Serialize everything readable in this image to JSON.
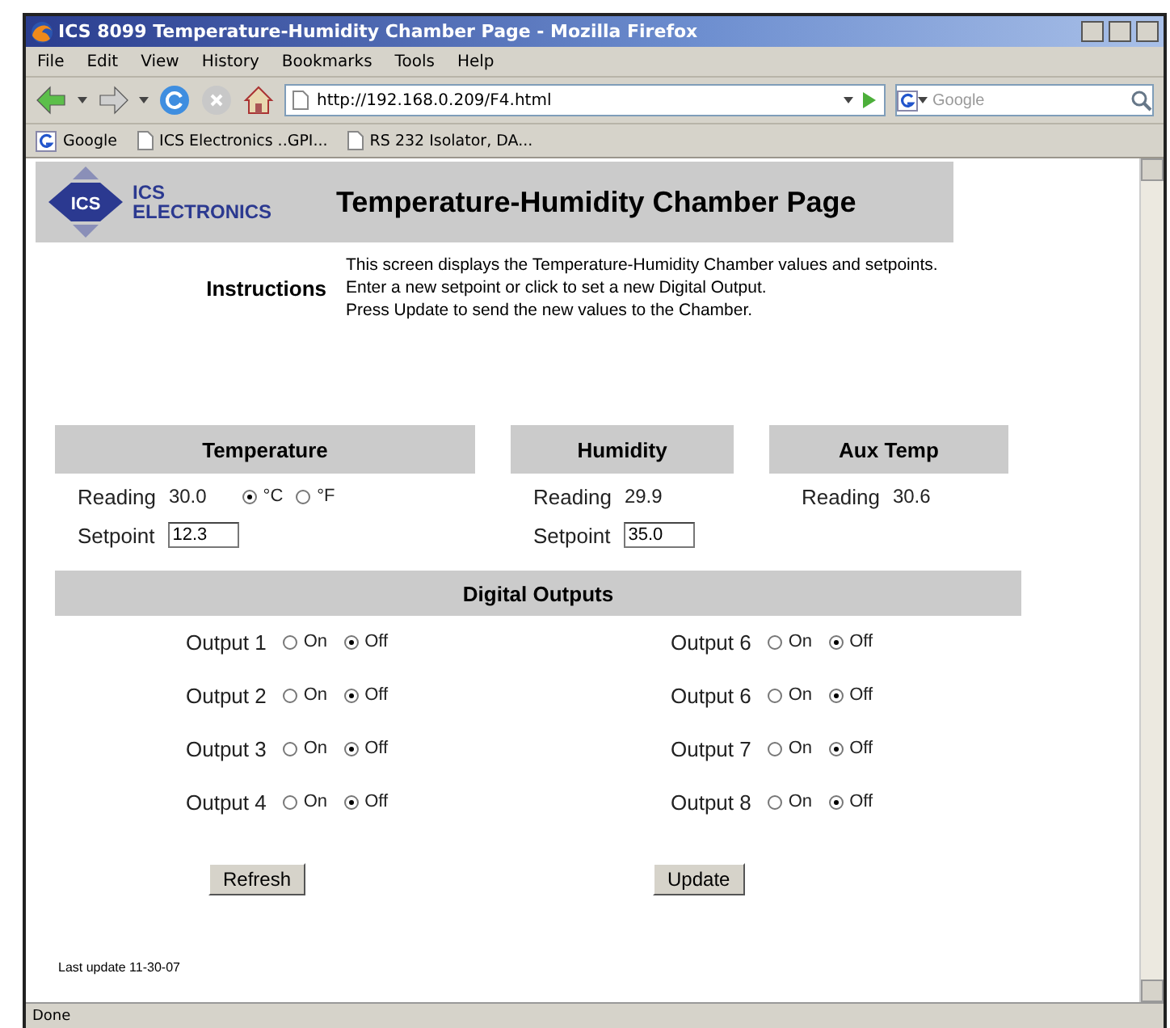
{
  "window": {
    "title": "ICS 8099 Temperature-Humidity Chamber Page - Mozilla Firefox"
  },
  "menu": [
    "File",
    "Edit",
    "View",
    "History",
    "Bookmarks",
    "Tools",
    "Help"
  ],
  "address": {
    "value": "http://192.168.0.209/F4.html"
  },
  "search": {
    "placeholder": "Google"
  },
  "bookmarks": [
    {
      "label": "Google",
      "kind": "google"
    },
    {
      "label": "ICS Electronics ..GPI...",
      "kind": "page"
    },
    {
      "label": "RS 232 Isolator, DA...",
      "kind": "page"
    }
  ],
  "logo": {
    "mark": "ICS",
    "line1": "ICS",
    "line2": "ELECTRONICS"
  },
  "page_title": "Temperature-Humidity Chamber Page",
  "instructions": {
    "heading": "Instructions",
    "lines": [
      "This screen displays the Temperature-Humidity Chamber values and setpoints.",
      "Enter a new setpoint or click to set a new Digital Output.",
      "Press Update to send the new values to the Chamber."
    ]
  },
  "temperature": {
    "heading": "Temperature",
    "reading_label": "Reading",
    "reading": "30.0",
    "units": [
      {
        "label": "°C",
        "selected": true
      },
      {
        "label": "°F",
        "selected": false
      }
    ],
    "setpoint_label": "Setpoint",
    "setpoint": "12.3"
  },
  "humidity": {
    "heading": "Humidity",
    "reading_label": "Reading",
    "reading": "29.9",
    "setpoint_label": "Setpoint",
    "setpoint": "35.0"
  },
  "aux_temp": {
    "heading": "Aux Temp",
    "reading_label": "Reading",
    "reading": "30.6"
  },
  "digital_outputs": {
    "heading": "Digital Outputs",
    "outputs": [
      {
        "label": "Output 1",
        "options": [
          {
            "label": "On",
            "selected": false
          },
          {
            "label": "Off",
            "selected": true
          }
        ]
      },
      {
        "label": "Output 6",
        "options": [
          {
            "label": "On",
            "selected": false
          },
          {
            "label": "Off",
            "selected": true
          }
        ]
      },
      {
        "label": "Output 2",
        "options": [
          {
            "label": "On",
            "selected": false
          },
          {
            "label": "Off",
            "selected": true
          }
        ]
      },
      {
        "label": "Output 6",
        "options": [
          {
            "label": "On",
            "selected": false
          },
          {
            "label": "Off",
            "selected": true
          }
        ]
      },
      {
        "label": "Output 3",
        "options": [
          {
            "label": "On",
            "selected": false
          },
          {
            "label": "Off",
            "selected": true
          }
        ]
      },
      {
        "label": "Output 7",
        "options": [
          {
            "label": "On",
            "selected": false
          },
          {
            "label": "Off",
            "selected": true
          }
        ]
      },
      {
        "label": "Output 4",
        "options": [
          {
            "label": "On",
            "selected": false
          },
          {
            "label": "Off",
            "selected": true
          }
        ]
      },
      {
        "label": "Output 8",
        "options": [
          {
            "label": "On",
            "selected": false
          },
          {
            "label": "Off",
            "selected": true
          }
        ]
      }
    ]
  },
  "buttons": [
    "Refresh",
    "Update"
  ],
  "last_update": "Last update 11-30-07",
  "status_bar": "Done"
}
